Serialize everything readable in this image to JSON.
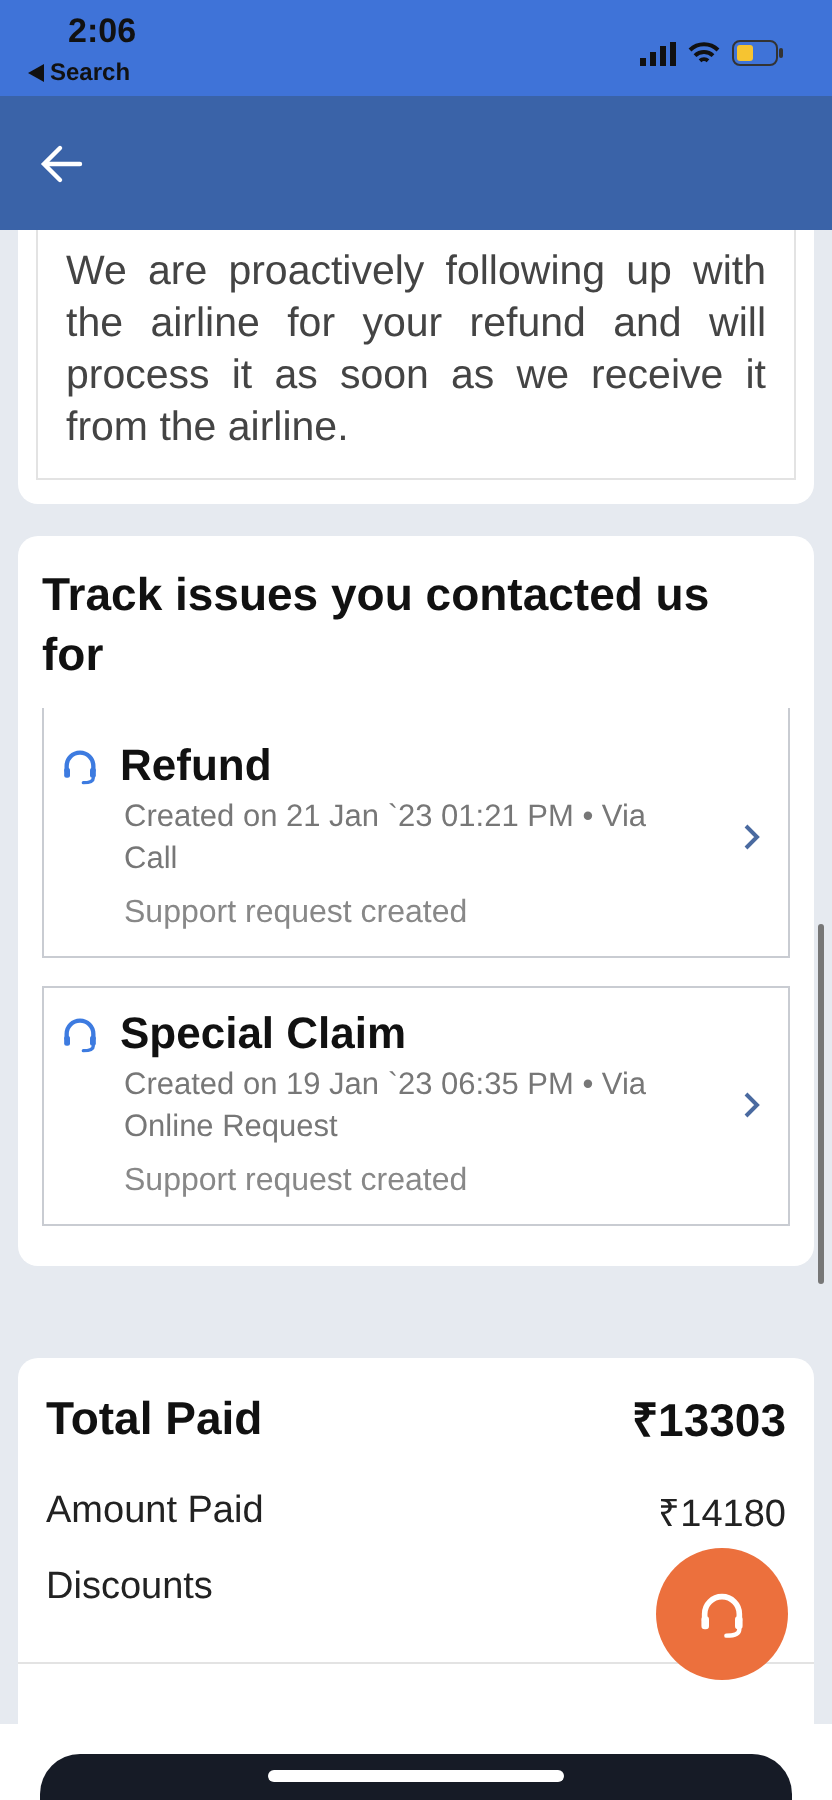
{
  "status_bar": {
    "time": "2:06",
    "back_label": "Search"
  },
  "notice": {
    "text": "We are proactively following up with the airline for your refund and will process it as soon as we receive it from the airline."
  },
  "issues_section": {
    "title": "Track issues you contacted us for",
    "issues": [
      {
        "title": "Refund",
        "meta": "Created on 21 Jan `23 01:21 PM  • Via Call",
        "status": "Support request created",
        "cut_top": true
      },
      {
        "title": "Special Claim",
        "meta": "Created on 19 Jan `23 06:35 PM  • Via Online Request",
        "status": "Support request created",
        "cut_top": false
      }
    ]
  },
  "payment": {
    "total_label": "Total Paid",
    "total_value": "₹13303",
    "rows": [
      {
        "label": "Amount Paid",
        "value": "₹14180"
      },
      {
        "label": "Discounts"
      }
    ]
  }
}
